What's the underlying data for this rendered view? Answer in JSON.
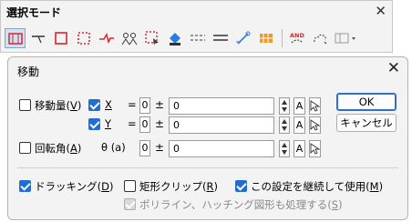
{
  "toolbar": {
    "title": "選択モード",
    "close_label": "✕",
    "buttons": [
      {
        "name": "select-window-icon"
      },
      {
        "name": "select-point-icon"
      },
      {
        "name": "select-rect-icon"
      },
      {
        "name": "select-dashed-rect-icon"
      },
      {
        "name": "select-line-icon"
      },
      {
        "name": "select-people-icon"
      },
      {
        "name": "select-area-icon"
      },
      {
        "name": "select-fill-icon"
      },
      {
        "name": "select-dashed-lines-icon"
      },
      {
        "name": "select-double-line-icon"
      },
      {
        "name": "select-measure-icon"
      },
      {
        "name": "select-hatch-icon"
      },
      {
        "name": "select-and-icon"
      },
      {
        "name": "select-cloud-icon"
      },
      {
        "name": "select-dropdown-icon"
      }
    ],
    "and_label": "AND"
  },
  "dialog": {
    "title": "移動",
    "close_label": "✕",
    "move_amount": {
      "label_pre": "移動量(",
      "key": "V",
      "label_post": ")",
      "checked": false
    },
    "x": {
      "label": "X",
      "checked": true,
      "eq": "=",
      "zero": "0",
      "pm": "±",
      "value": "0",
      "a": "A"
    },
    "y": {
      "label": "Y",
      "checked": true,
      "eq": "=",
      "zero": "0",
      "pm": "±",
      "value": "0",
      "a": "A"
    },
    "rotate": {
      "label_pre": "回転角(",
      "key": "A",
      "label_post": ")",
      "checked": false,
      "theta": "θ (a)",
      "zero": "0",
      "pm": "±",
      "value": "0",
      "a": "A"
    },
    "ok_label": "OK",
    "cancel_label": "キャンセル",
    "dragging": {
      "label_pre": "ドラッキング(",
      "key": "D",
      "label_post": ")",
      "checked": true
    },
    "rect_clip": {
      "label_pre": "矩形クリップ(",
      "key": "R",
      "label_post": ")",
      "checked": false
    },
    "continue": {
      "label_pre": "この設定を継続して使用(",
      "key": "M",
      "label_post": ")",
      "checked": true
    },
    "polyline": {
      "label_pre": "ポリライン、ハッチング図形も処理する(",
      "key": "S",
      "label_post": ")",
      "checked": true,
      "disabled": true
    }
  }
}
